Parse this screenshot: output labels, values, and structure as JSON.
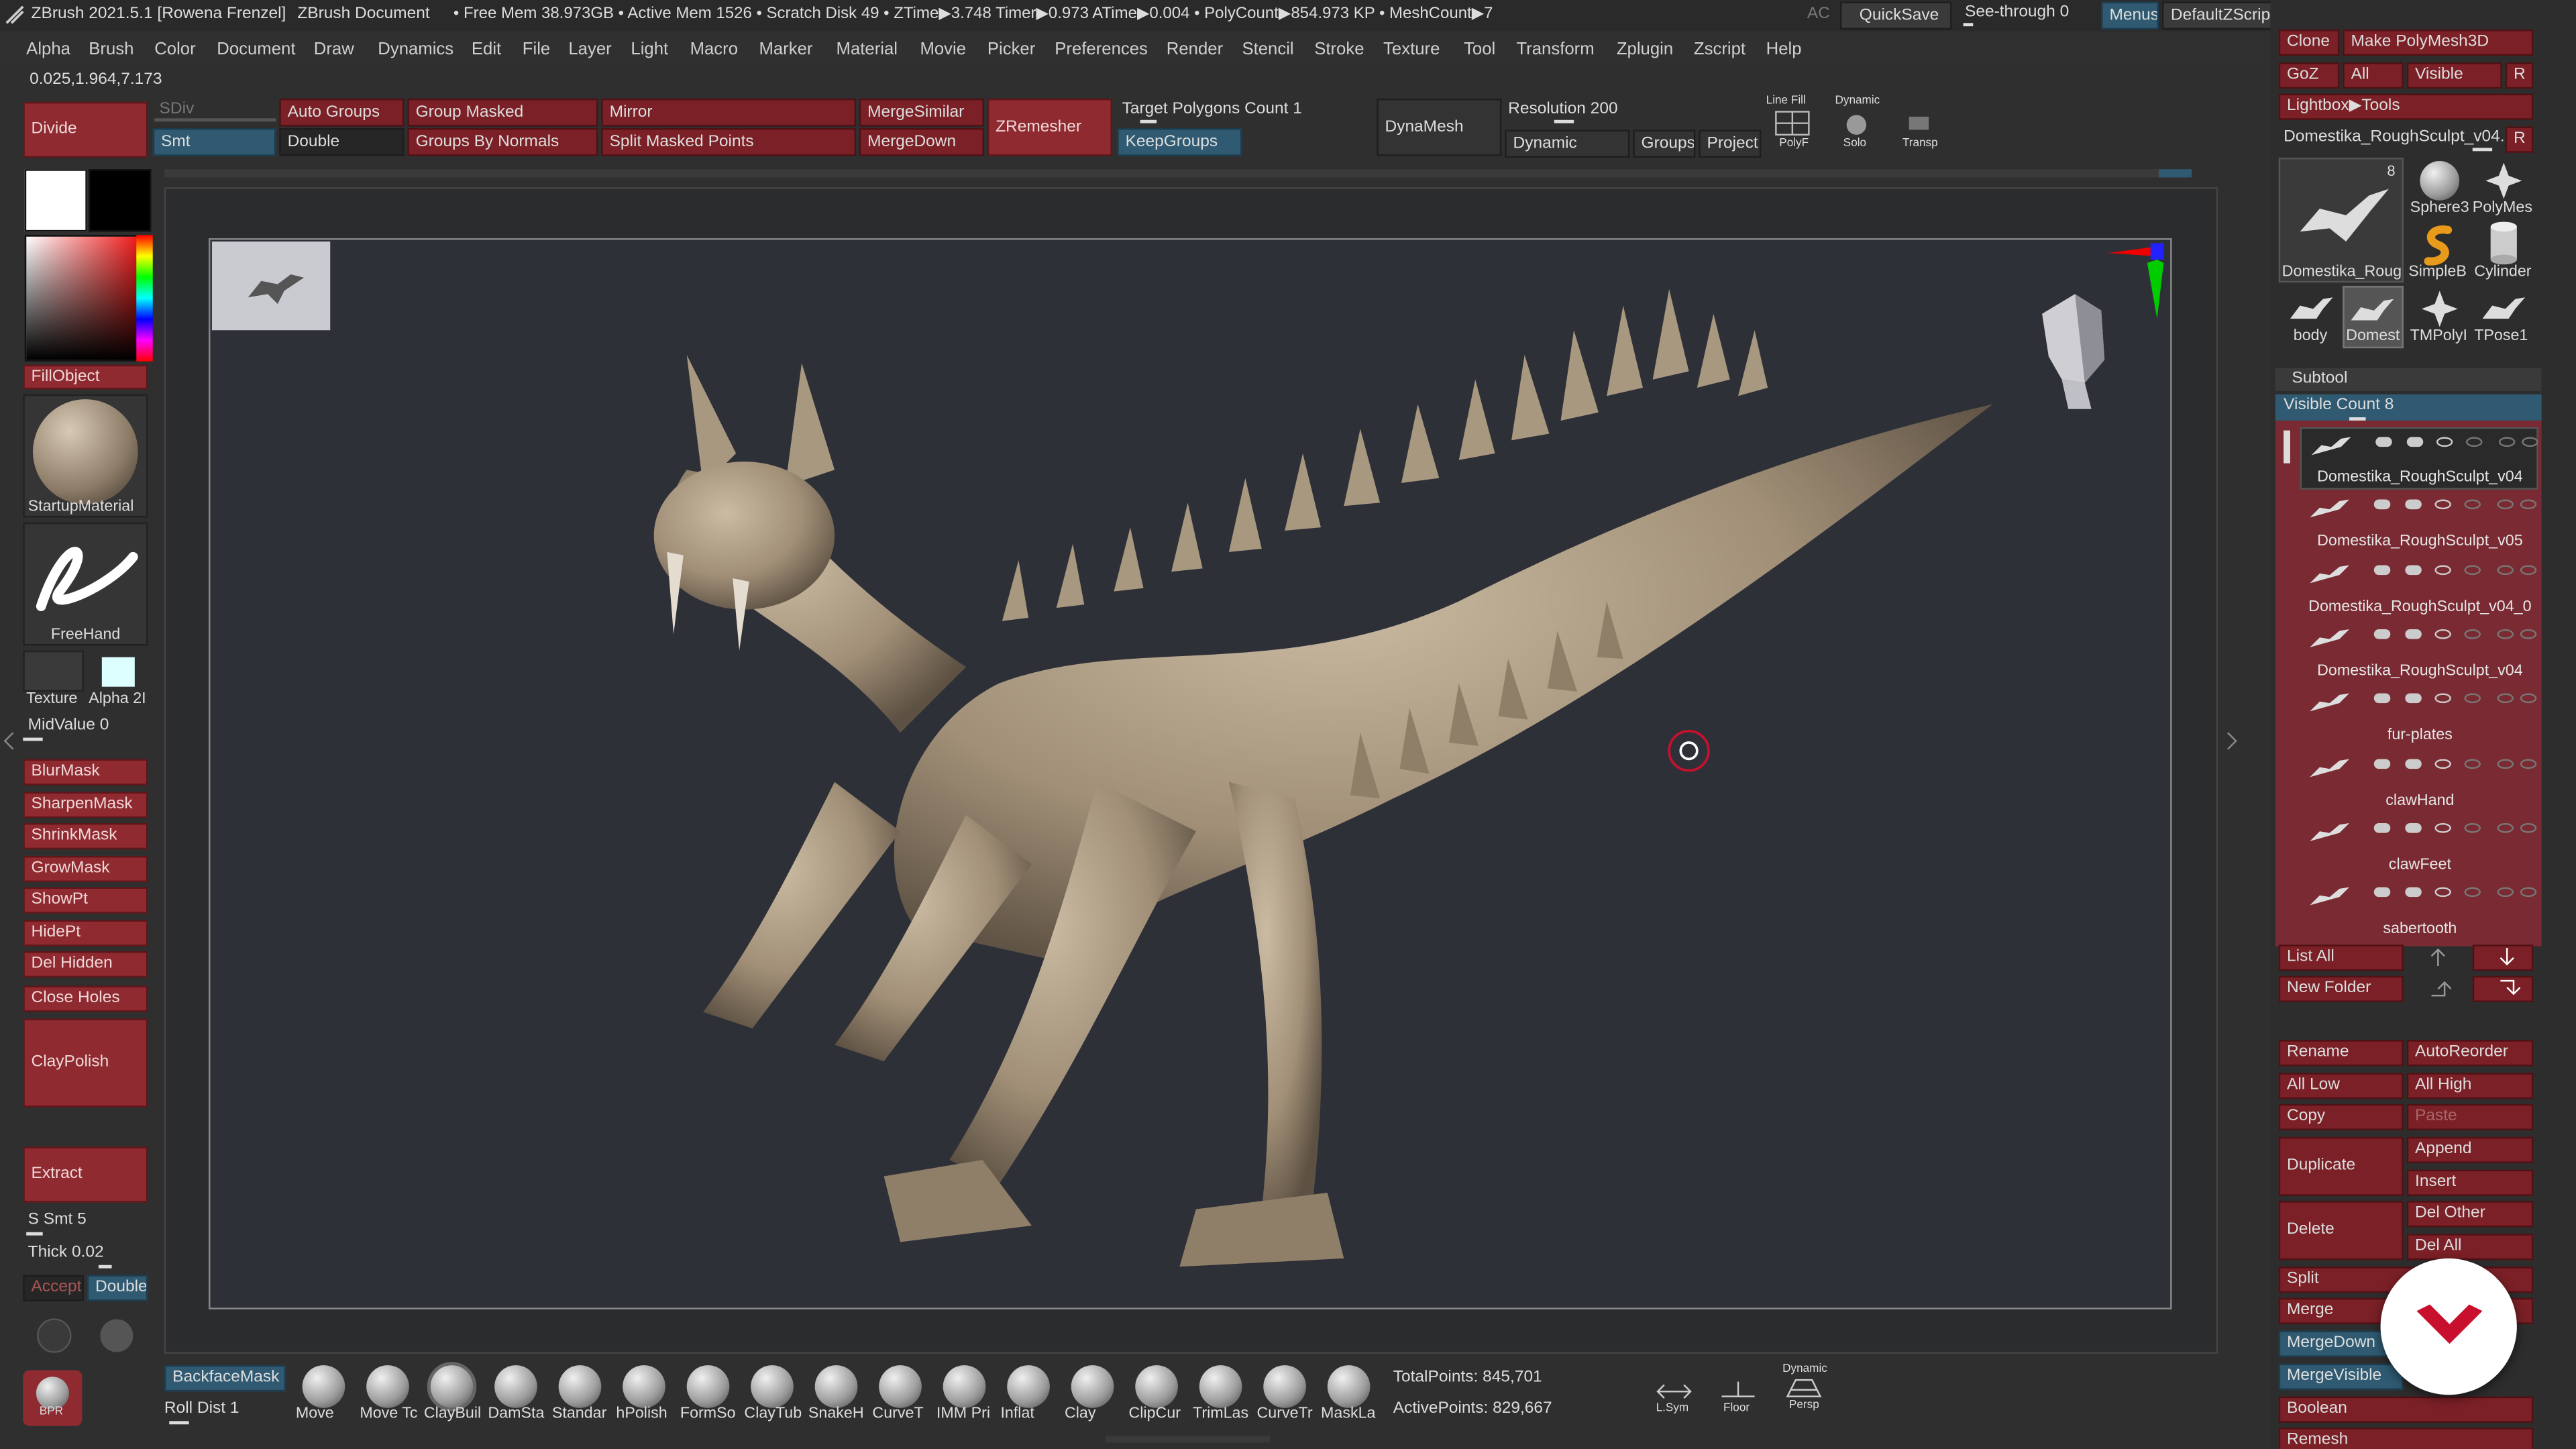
{
  "titlebar": {
    "app": "ZBrush 2021.5.1 [Rowena Frenzel]",
    "doc": "ZBrush Document",
    "stats": "• Free Mem 38.973GB • Active Mem 1526 • Scratch Disk 49 • ZTime▶3.748 Timer▶0.973 ATime▶0.004 • PolyCount▶854.973 KP • MeshCount▶7",
    "ac": "AC",
    "quicksave": "QuickSave",
    "seethrough": "See-through  0",
    "menus": "Menus",
    "defaultzscript": "DefaultZScript"
  },
  "menubar": [
    "Alpha",
    "Brush",
    "Color",
    "Document",
    "Draw",
    "Dynamics",
    "Edit",
    "File",
    "Layer",
    "Light",
    "Macro",
    "Marker",
    "Material",
    "Movie",
    "Picker",
    "Preferences",
    "Render",
    "Stencil",
    "Stroke",
    "Texture",
    "Tool",
    "Transform",
    "Zplugin",
    "Zscript",
    "Help"
  ],
  "coords": "0.025,1.964,7.173",
  "toolbar": {
    "divide": "Divide",
    "sdiv": "SDiv",
    "smt": "Smt",
    "auto_groups": "Auto Groups",
    "double": "Double",
    "group_masked": "Group Masked",
    "groups_by_normals": "Groups By Normals",
    "mirror": "Mirror",
    "split_masked_points": "Split Masked Points",
    "merge_similar": "MergeSimilar",
    "merge_down": "MergeDown",
    "zremesher": "ZRemesher",
    "target_polygons": "Target Polygons Count 1",
    "keep_groups": "KeepGroups",
    "dynamesh": "DynaMesh",
    "resolution": "Resolution 200",
    "dynamic": "Dynamic",
    "groups": "Groups",
    "project": "Project",
    "linefill": "Line Fill",
    "polyf": "PolyF",
    "solo_top": "Dynamic",
    "solo": "Solo",
    "transp": "Transp"
  },
  "leftshelf": {
    "fillobject": "FillObject",
    "material": "StartupMaterial",
    "stroke": "FreeHand",
    "texture": "Texture",
    "alpha": "Alpha 2I",
    "midvalue": "MidValue 0",
    "buttons": [
      "BlurMask",
      "SharpenMask",
      "ShrinkMask",
      "GrowMask",
      "ShowPt",
      "HidePt",
      "Del Hidden",
      "Close Holes"
    ],
    "claypolish": "ClayPolish",
    "extract": "Extract",
    "ssmt": "S Smt 5",
    "thick": "Thick 0.02",
    "accept": "Accept",
    "double": "Double",
    "bpr": "BPR"
  },
  "bottom": {
    "backface": "BackfaceMask",
    "rolldist": "Roll Dist 1",
    "brushes": [
      "Move",
      "Move Tc",
      "ClayBuil",
      "DamSta",
      "Standar",
      "hPolish",
      "FormSo",
      "ClayTub",
      "SnakeH",
      "CurveT",
      "IMM Pri",
      "Inflat",
      "Clay",
      "ClipCur",
      "TrimLas",
      "CurveTr",
      "MaskLa"
    ],
    "totalpoints": "TotalPoints: 845,701",
    "activepoints": "ActivePoints: 829,667",
    "lsym": "L.Sym",
    "floor": "Floor",
    "persp_top": "Dynamic",
    "persp": "Persp"
  },
  "right": {
    "clone": "Clone",
    "make_polymesh": "Make PolyMesh3D",
    "goz": "GoZ",
    "all": "All",
    "visible": "Visible",
    "r": "R",
    "lightbox_tools": "Lightbox▶Tools",
    "current_tool": "Domestika_RoughSculpt_v04.",
    "tool_count": "8",
    "thumbs": [
      "Domestika_Roug",
      "Sphere3",
      "PolyMes",
      "SimpleB",
      "Cylinder",
      "body",
      "Domest",
      "TMPolyI",
      "TPose1"
    ],
    "subtool_header": "Subtool",
    "visible_count": "Visible Count 8",
    "subtools": [
      "Domestika_RoughSculpt_v04",
      "Domestika_RoughSculpt_v05",
      "Domestika_RoughSculpt_v04_0",
      "Domestika_RoughSculpt_v04",
      "fur-plates",
      "clawHand",
      "clawFeet",
      "sabertooth"
    ],
    "list_all": "List All",
    "new_folder": "New Folder",
    "rename": "Rename",
    "autoreorder": "AutoReorder",
    "all_low": "All Low",
    "all_high": "All High",
    "copy": "Copy",
    "paste": "Paste",
    "duplicate": "Duplicate",
    "append": "Append",
    "insert": "Insert",
    "delete": "Delete",
    "del_other": "Del Other",
    "del_all": "Del All",
    "split": "Split",
    "merge": "Merge",
    "mergedown": "MergeDown",
    "mergevisible": "MergeVisible",
    "boolean": "Boolean",
    "remesh": "Remesh"
  },
  "colors": {
    "accent_red": "#8e2a30",
    "accent_blue": "#2f5a72",
    "clay": "#a89880",
    "badge": "#c8102e"
  }
}
